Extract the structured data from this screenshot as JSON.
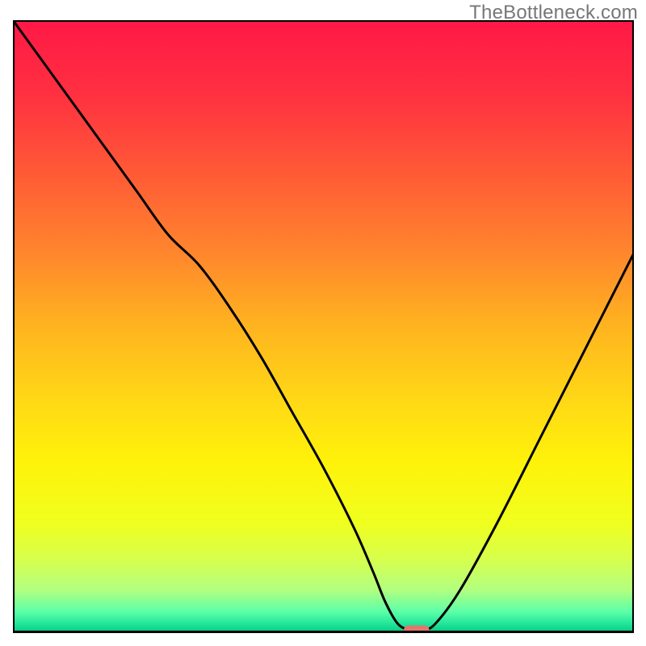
{
  "watermark": "TheBottleneck.com",
  "chart_data": {
    "type": "line",
    "title": "",
    "xlabel": "",
    "ylabel": "",
    "xlim": [
      0,
      100
    ],
    "ylim": [
      0,
      100
    ],
    "grid": false,
    "legend": false,
    "background_gradient": {
      "stops": [
        {
          "offset": 0.0,
          "color": "#ff1846"
        },
        {
          "offset": 0.12,
          "color": "#ff3041"
        },
        {
          "offset": 0.25,
          "color": "#ff5a36"
        },
        {
          "offset": 0.38,
          "color": "#ff862d"
        },
        {
          "offset": 0.5,
          "color": "#ffb41f"
        },
        {
          "offset": 0.62,
          "color": "#ffd816"
        },
        {
          "offset": 0.72,
          "color": "#fff20a"
        },
        {
          "offset": 0.82,
          "color": "#f0ff1e"
        },
        {
          "offset": 0.88,
          "color": "#d6ff4d"
        },
        {
          "offset": 0.93,
          "color": "#b1ff80"
        },
        {
          "offset": 0.965,
          "color": "#5dffa8"
        },
        {
          "offset": 0.985,
          "color": "#22e59a"
        },
        {
          "offset": 1.0,
          "color": "#00c87f"
        }
      ]
    },
    "series": [
      {
        "name": "bottleneck-curve",
        "color": "#000000",
        "x": [
          0,
          5,
          10,
          15,
          20,
          25,
          30,
          35,
          40,
          45,
          50,
          55,
          58,
          60,
          62,
          64,
          66,
          68,
          72,
          78,
          85,
          92,
          100
        ],
        "values": [
          100,
          93,
          86,
          79,
          72,
          65,
          60,
          53,
          45,
          36,
          27,
          17,
          10,
          5,
          1.5,
          0.5,
          0.5,
          1.5,
          7,
          18,
          32,
          46,
          62
        ]
      }
    ],
    "marker": {
      "name": "optimal-point",
      "shape": "rounded-rect",
      "color": "#e0776f",
      "x": 65,
      "y": 0.5,
      "width_pct": 4.1,
      "height_pct": 1.5
    }
  }
}
